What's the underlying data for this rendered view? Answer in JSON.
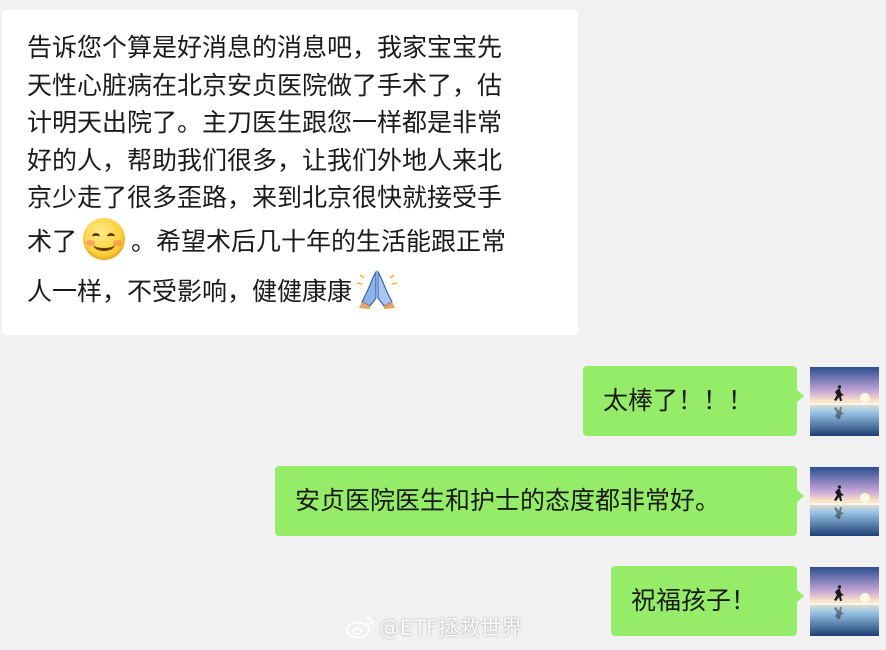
{
  "chat": {
    "incoming": {
      "lines": [
        "告诉您个算是好消息的消息吧，我家宝宝先",
        "天性心脏病在北京安贞医院做了手术了，估",
        "计明天出院了。主刀医生跟您一样都是非常",
        "好的人，帮助我们很多，让我们外地人来北",
        "京少走了很多歪路，来到北京很快就接受手"
      ],
      "line6_before_emoji": "术了",
      "line6_after_emoji": "。希望术后几十年的生活能跟正常",
      "line7_before_emoji": "人一样，不受影响，健健康康",
      "emojis": [
        "smile-emoji",
        "folded-hands-emoji"
      ]
    },
    "outgoing": [
      {
        "text": "太棒了！！！"
      },
      {
        "text": "安贞医院医生和护士的态度都非常好。"
      },
      {
        "text": "祝福孩子！"
      }
    ]
  },
  "watermark": {
    "text": "@ETF拯救世界",
    "icon": "weibo-icon"
  },
  "colors": {
    "background": "#f1f1f1",
    "incoming_bubble": "#ffffff",
    "outgoing_bubble": "#95ec69"
  }
}
